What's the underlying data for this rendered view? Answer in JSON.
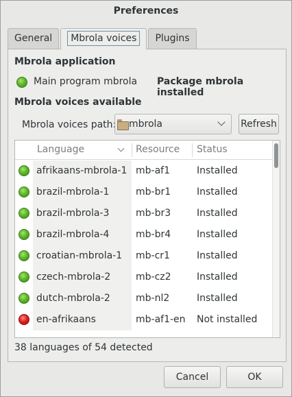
{
  "window": {
    "title": "Preferences"
  },
  "tabs": [
    {
      "label": "General"
    },
    {
      "label": "Mbrola voices"
    },
    {
      "label": "Plugins"
    }
  ],
  "mbrola_app": {
    "heading": "Mbrola application",
    "main_program_label": "Main program mbrola",
    "package_status": "Package mbrola installed"
  },
  "voices": {
    "heading": "Mbrola voices available",
    "path_label": "Mbrola voices path:",
    "path_value": "mbrola",
    "refresh_label": "Refresh",
    "columns": {
      "language": "Language",
      "resource": "Resource",
      "status": "Status"
    },
    "rows": [
      {
        "language": "afrikaans-mbrola-1",
        "resource": "mb-af1",
        "status": "Installed",
        "installed": true
      },
      {
        "language": "brazil-mbrola-1",
        "resource": "mb-br1",
        "status": "Installed",
        "installed": true
      },
      {
        "language": "brazil-mbrola-3",
        "resource": "mb-br3",
        "status": "Installed",
        "installed": true
      },
      {
        "language": "brazil-mbrola-4",
        "resource": "mb-br4",
        "status": "Installed",
        "installed": true
      },
      {
        "language": "croatian-mbrola-1",
        "resource": "mb-cr1",
        "status": "Installed",
        "installed": true
      },
      {
        "language": "czech-mbrola-2",
        "resource": "mb-cz2",
        "status": "Installed",
        "installed": true
      },
      {
        "language": "dutch-mbrola-2",
        "resource": "mb-nl2",
        "status": "Installed",
        "installed": true
      },
      {
        "language": "en-afrikaans",
        "resource": "mb-af1-en",
        "status": "Not installed",
        "installed": false
      }
    ],
    "summary": "38 languages of 54 detected"
  },
  "buttons": {
    "cancel": "Cancel",
    "ok": "OK"
  },
  "colors": {
    "installed": "#5cb82a",
    "not_installed": "#e02020"
  }
}
